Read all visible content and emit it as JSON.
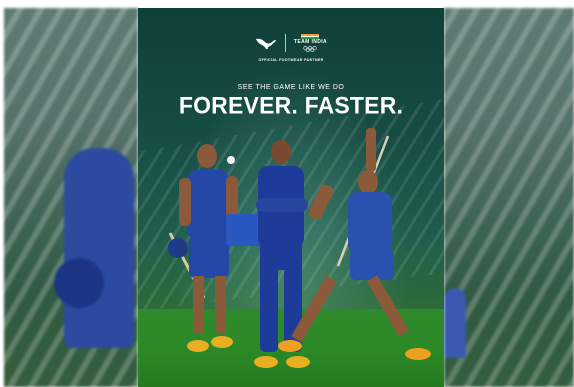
{
  "poster": {
    "brand_lettering": "PUMA",
    "team_label": "TEAM INDIA",
    "partner_text": "OFFICIAL FOOTWEAR PARTNER",
    "tagline": "SEE THE GAME LIKE WE DO",
    "headline": "FOREVER. FASTER."
  },
  "athletes": [
    {
      "role": "cricketer",
      "colors": {
        "jersey": "#2448a8",
        "shoes": "#e8b020"
      }
    },
    {
      "role": "sprinter",
      "colors": {
        "tracksuit": "#1d3c9a",
        "shoes": "#e8b020"
      }
    },
    {
      "role": "javelin-thrower",
      "colors": {
        "jersey": "#2a50b0",
        "shoes": "#f0a020"
      }
    }
  ],
  "colors": {
    "background_dark": "#0f3f39",
    "pitch_green": "#2f8a2c",
    "kit_blue": "#2448a8",
    "shoe_gold": "#e8b020"
  }
}
